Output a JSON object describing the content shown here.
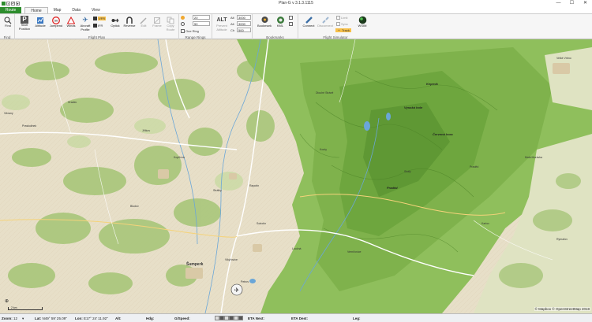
{
  "window": {
    "title": "Plan-G v 3.1.3.1115",
    "minimize": "—",
    "maximize": "☐",
    "close": "✕"
  },
  "tabs": [
    {
      "label": "Route"
    },
    {
      "label": "Home"
    },
    {
      "label": "Map"
    },
    {
      "label": "Data"
    },
    {
      "label": "View"
    }
  ],
  "ribbon": {
    "find": {
      "label": "Find",
      "group": "Find"
    },
    "flight_plan": {
      "group": "Flight Plan",
      "buttons": [
        {
          "label": "Start\nPosition"
        },
        {
          "label": "Altitude"
        },
        {
          "label": "Jumpend"
        },
        {
          "label": "Winds"
        },
        {
          "label": "Aircraft\nProfile"
        },
        {
          "label": "VFR"
        },
        {
          "label": "IFR"
        },
        {
          "label": "Optick"
        },
        {
          "label": "Reverse"
        },
        {
          "label": "Edit"
        },
        {
          "label": "Frame"
        },
        {
          "label": "Copy\nRoute"
        }
      ]
    },
    "range_rings": {
      "group": "Range Rings",
      "value1": "20",
      "value2": "50",
      "one_ring": "One Ring"
    },
    "alt": {
      "label": "ALT",
      "sublabel": "Prevent\nAltitude",
      "f1_label": "Alt",
      "f1_value": "3000",
      "f2_label": "Alt",
      "f2_value": "3000",
      "f3_label": "Ch",
      "f3_value": "500"
    },
    "bookmarks": {
      "group": "Bookmarks",
      "bookmark": "Bookmark",
      "kml": "KML"
    },
    "flight_simulator": {
      "group": "Flight Simulator",
      "connect": "Connect",
      "disconnect": "Disconnect",
      "limit": "Limit",
      "sync": "Sync",
      "track": "Track",
      "wsim": "WSIM"
    }
  },
  "map": {
    "places": [
      {
        "label": "Vikrany"
      },
      {
        "label": "Praskulinek"
      },
      {
        "label": "Velké Vrbno"
      },
      {
        "label": "Hradec"
      },
      {
        "label": "Jiříkov"
      },
      {
        "label": "Bludov"
      },
      {
        "label": "Šumperk"
      },
      {
        "label": "Petrov"
      },
      {
        "label": "Vikýřovice"
      },
      {
        "label": "Rapotín"
      },
      {
        "label": "Loučná"
      },
      {
        "label": "Kouty"
      },
      {
        "label": "Kopřivná"
      },
      {
        "label": "Dlouhé Stráně"
      },
      {
        "label": "Praděd"
      },
      {
        "label": "Malá Morávka"
      },
      {
        "label": "Karlov"
      },
      {
        "label": "Rýmařov"
      },
      {
        "label": "Skály"
      },
      {
        "label": "Strálky"
      },
      {
        "label": "Vernířovice"
      },
      {
        "label": "Sobotín"
      }
    ],
    "peaks": [
      {
        "label": "Keprník"
      },
      {
        "label": "Červená hora"
      },
      {
        "label": "Praděd"
      },
      {
        "label": "Vysoká hole"
      }
    ],
    "copyright": "© Mapbox © OpenStreetMap 2018",
    "scale_label": "2 km"
  },
  "status": {
    "zoom_label": "Zoom:",
    "zoom_value": "12",
    "lat_label": "Lat:",
    "lat_value": "N49° 59' 25.09\"",
    "lon_label": "Lon:",
    "lon_value": "E17° 24' 11.92\"",
    "alt_label": "Alt:",
    "hdg_label": "Hdg:",
    "gs_label": "G/Speed:",
    "eta_next_label": "ETA Next:",
    "eta_dest_label": "ETA Dest:",
    "leg_label": "Leg:"
  },
  "colors": {
    "file_tab": "#2d8d2d",
    "forest": "#8fbf5c",
    "farmland": "#e7dfc8",
    "river": "#6aa6d8",
    "road": "#ffffff"
  }
}
